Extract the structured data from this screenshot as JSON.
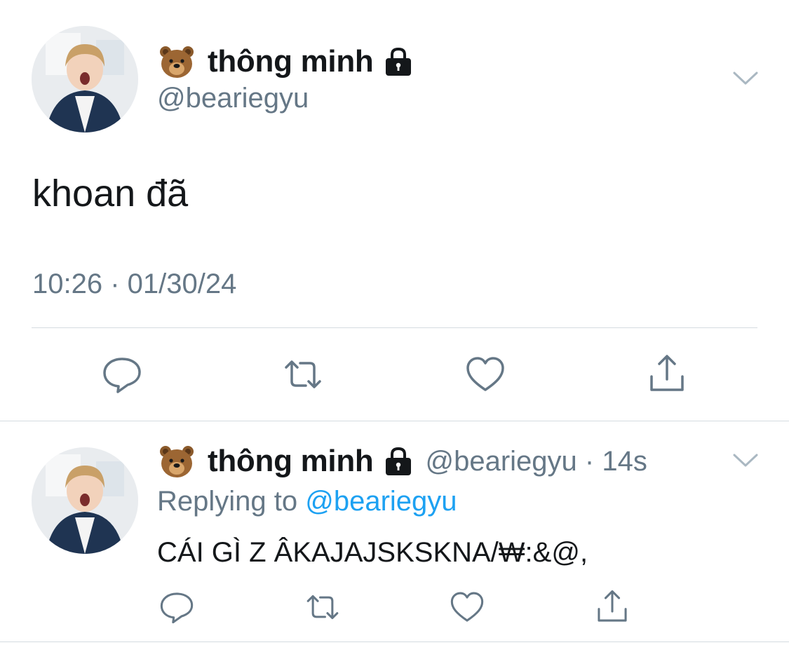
{
  "main_tweet": {
    "display_name": "thông minh",
    "handle": "@beariegyu",
    "text": "khoan đã",
    "timestamp": "10:26 · 01/30/24",
    "name_emoji_icon": "bear-face-icon",
    "protected_icon": "lock-icon",
    "menu_icon": "chevron-down-icon",
    "actions": [
      "reply-icon",
      "retweet-icon",
      "like-icon",
      "share-icon"
    ]
  },
  "reply_tweet": {
    "display_name": "thông minh",
    "handle_time": "@beariegyu · 14s",
    "replying_prefix": "Replying to",
    "replying_mention": "@beariegyu",
    "text": "CÁI GÌ Z ÂKAJAJSKSKNA/₩:&@,",
    "name_emoji_icon": "bear-face-icon",
    "protected_icon": "lock-icon",
    "menu_icon": "chevron-down-icon",
    "actions": [
      "reply-icon",
      "retweet-icon",
      "like-icon",
      "share-icon"
    ]
  },
  "colors": {
    "text_primary": "#14171a",
    "text_secondary": "#657786",
    "link": "#1da1f2",
    "icon": "#657786",
    "divider": "#d5dbe0"
  }
}
